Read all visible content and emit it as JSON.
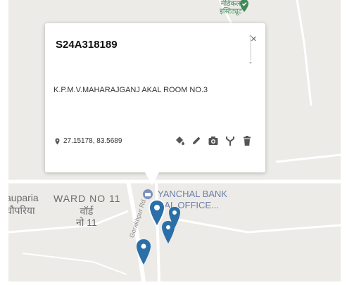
{
  "popup": {
    "title": "S24A318189",
    "address": "K.P.M.V.MAHARAJGANJ AKAL ROOM NO.3",
    "coordinates": "27.15178, 83.5689",
    "close_glyph": "×",
    "tools": [
      "paint-bucket-icon",
      "pencil-icon",
      "camera-icon",
      "merge-icon",
      "trash-icon"
    ]
  },
  "map": {
    "ward_label": "WARD NO 11",
    "ward_label_hindi_1": "वॉर्ड",
    "ward_label_hindi_2": "नो 11",
    "village_label_1": "auparia",
    "village_label_2": "चौपरिया",
    "bank_label_1": "YANCHAL BANK",
    "bank_label_2": "NAL OFFICE...",
    "place_label_top": "मेडिकल",
    "place_label_top_2": "इस्टिट्यूट",
    "road_label": "Gorakhpur Rd"
  },
  "colors": {
    "map_bg": "#ecebe8",
    "pin": "#2a6fa8",
    "green_pin": "#3f8a57"
  }
}
